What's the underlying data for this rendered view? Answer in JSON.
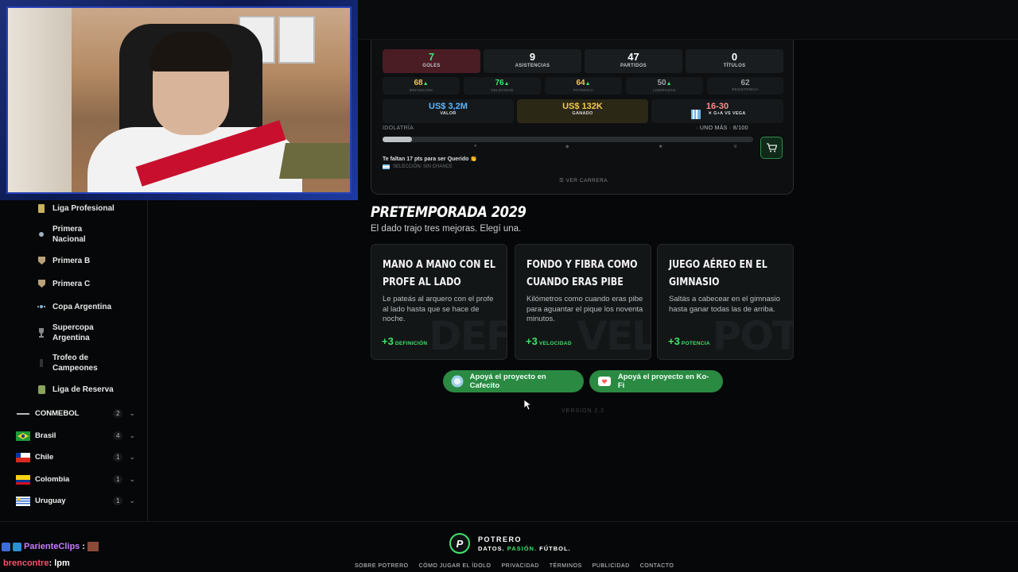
{
  "profile": {
    "stats": [
      {
        "value": "7",
        "label": "GOLES",
        "color": "#3fe36b",
        "bg": "#4a1c24"
      },
      {
        "value": "9",
        "label": "ASISTENCIAS",
        "color": "#ffffff",
        "bg": "#1a1d1f"
      },
      {
        "value": "47",
        "label": "PARTIDOS",
        "color": "#ffffff",
        "bg": "#1a1d1f"
      },
      {
        "value": "0",
        "label": "TÍTULOS",
        "color": "#ffffff",
        "bg": "#1a1d1f"
      }
    ],
    "attributes": [
      {
        "value": "68",
        "label": "DEFINICIÓN",
        "color": "#f2c94c",
        "up": true
      },
      {
        "value": "76",
        "label": "VELOCIDAD",
        "color": "#3fe36b",
        "up": true
      },
      {
        "value": "64",
        "label": "POTENCIA",
        "color": "#f2c94c",
        "up": true
      },
      {
        "value": "50",
        "label": "LIDERAZGO",
        "color": "#9aa0a5",
        "up": true
      },
      {
        "value": "62",
        "label": "RESISTENCIA",
        "color": "#9aa0a5",
        "up": false
      }
    ],
    "money": [
      {
        "value": "US$ 3,2M",
        "label": "VALOR",
        "color": "#5ab6ff",
        "bg": "#16191b"
      },
      {
        "value": "US$ 132K",
        "label": "GANADO",
        "color": "#f2c94c",
        "bg": "#2c2816"
      },
      {
        "value": "16-30",
        "label": "G+A VS VEGA",
        "color": "#ff6b6b",
        "bg": "#16191b",
        "prefix": "✕"
      }
    ],
    "idolatria_label": "IDOLATRÍA",
    "idolatria_status": "· UNO MÁS · 8/100",
    "idolatria_progress": 0.08,
    "hint": "Te faltan 17 pts para ser Querido 👏",
    "selection": "SELECCIÓN: SIN CHANCE",
    "ver_carrera": "VER CARRERA"
  },
  "pretemporada": {
    "title": "PRETEMPORADA 2029",
    "subtitle": "El dado trajo tres mejoras. Elegí una.",
    "cards": [
      {
        "title_line1": "MANO A MANO CON EL",
        "title_line2": "PROFE AL LADO",
        "desc": "Le pateás al arquero con el profe al lado hasta que se hace de noche.",
        "bonus": "+3",
        "stat": "DEFINICIÓN",
        "watermark": "DEF"
      },
      {
        "title_line1": "FONDO Y FIBRA COMO",
        "title_line2": "CUANDO ERAS PIBE",
        "desc": "Kilómetros como cuando eras pibe para aguantar el pique los noventa minutos.",
        "bonus": "+3",
        "stat": "VELOCIDAD",
        "watermark": "VEL"
      },
      {
        "title_line1": "JUEGO AÉREO EN EL",
        "title_line2": "GIMNASIO",
        "desc": "Saltás a cabecear en el gimnasio hasta ganar todas las de arriba.",
        "bonus": "+3",
        "stat": "POTENCIA",
        "watermark": "POT"
      }
    ]
  },
  "support": {
    "cafecito": "Apoyá el proyecto en Cafecito",
    "kofi": "Apoyá el proyecto en Ko-Fi"
  },
  "version": "VERSIÓN 2.2",
  "sidebar": {
    "leagues": [
      {
        "label": "Liga Profesional"
      },
      {
        "label": "Primera Nacional"
      },
      {
        "label": "Primera B"
      },
      {
        "label": "Primera C"
      },
      {
        "label": "Copa Argentina"
      },
      {
        "label": "Supercopa Argentina"
      },
      {
        "label": "Trofeo de Campeones"
      },
      {
        "label": "Liga de Reserva"
      }
    ],
    "confederations": [
      {
        "label": "CONMEBOL",
        "count": "2"
      },
      {
        "label": "Brasil",
        "count": "4"
      },
      {
        "label": "Chile",
        "count": "1"
      },
      {
        "label": "Colombia",
        "count": "1"
      },
      {
        "label": "Uruguay",
        "count": "1"
      }
    ]
  },
  "footer": {
    "brand": "POTRERO",
    "tag_a": "DATOS.",
    "tag_b": "PASIÓN.",
    "tag_c": "FÚTBOL.",
    "links": [
      "SOBRE POTRERO",
      "CÓMO JUGAR EL ÍDOLO",
      "PRIVACIDAD",
      "TÉRMINOS",
      "PUBLICIDAD",
      "CONTACTO"
    ]
  },
  "chat": [
    {
      "user": "ParienteClips",
      "message": ":",
      "color": "#c77dff"
    },
    {
      "user": "brencontre",
      "message": ": lpm",
      "color": "#ff4d6d"
    }
  ]
}
